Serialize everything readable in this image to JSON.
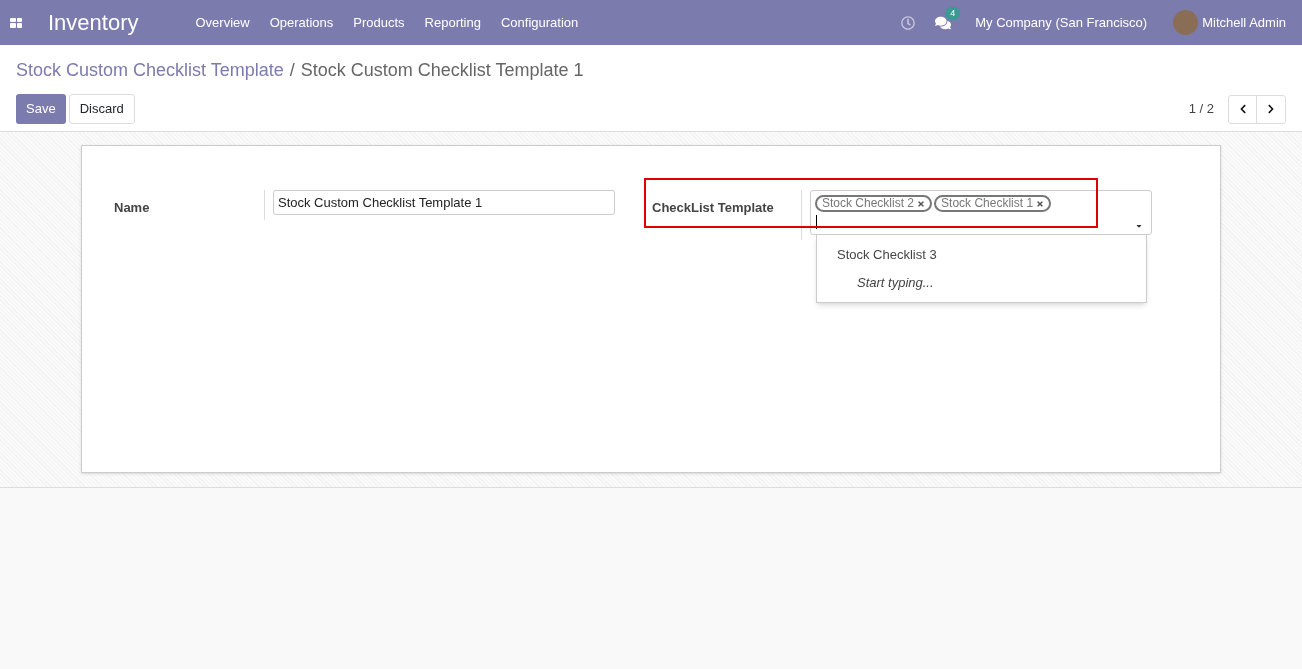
{
  "navbar": {
    "app_name": "Inventory",
    "menus": [
      "Overview",
      "Operations",
      "Products",
      "Reporting",
      "Configuration"
    ],
    "messages_count": "4",
    "company": "My Company (San Francisco)",
    "user": "Mitchell Admin"
  },
  "breadcrumb": {
    "parent": "Stock Custom Checklist Template",
    "separator": "/",
    "current": "Stock Custom Checklist Template 1"
  },
  "buttons": [
    {
      "label": "Save",
      "kind": "primary"
    },
    {
      "label": "Discard",
      "kind": "secondary"
    }
  ],
  "pager": {
    "text": "1 / 2"
  },
  "form": {
    "name": {
      "label": "Name",
      "value": "Stock Custom Checklist Template 1"
    },
    "checklist": {
      "label": "CheckList Template",
      "highlighted": true,
      "tags": [
        "Stock Checklist 2",
        "Stock Checklist 1"
      ],
      "dropdown": [
        {
          "label": "Stock Checklist 3",
          "kind": "option"
        },
        {
          "label": "Start typing...",
          "kind": "hint"
        }
      ]
    }
  }
}
